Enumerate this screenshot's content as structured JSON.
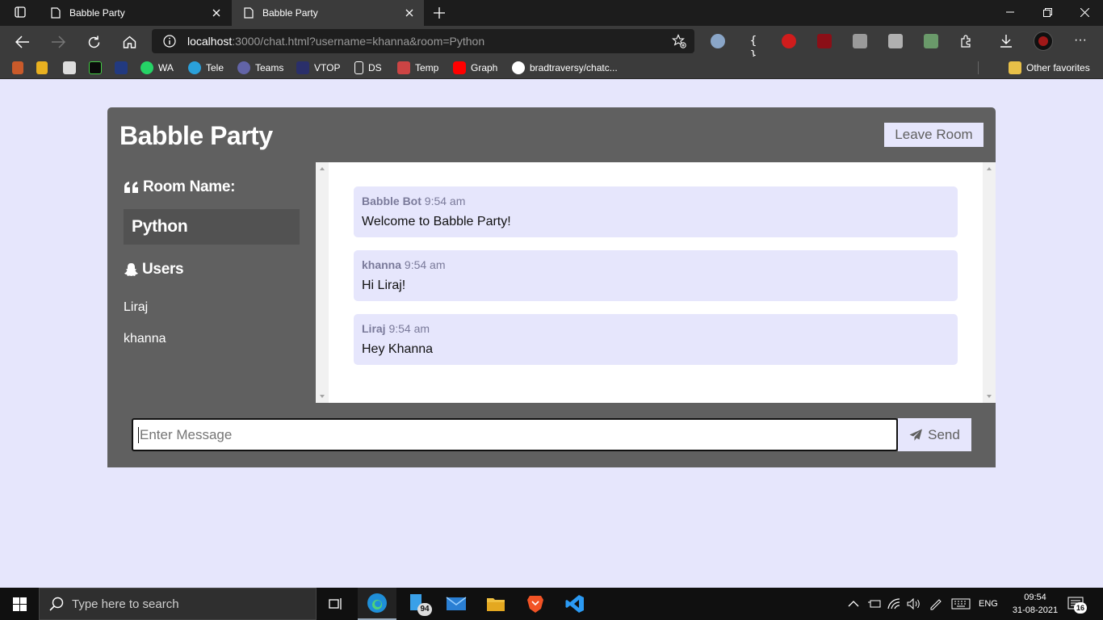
{
  "browser": {
    "tabs": [
      {
        "title": "Babble Party"
      },
      {
        "title": "Babble Party"
      }
    ],
    "url_host": "localhost",
    "url_rest": ":3000/chat.html?username=khanna&room=Python",
    "bookmarks": [
      "WA",
      "Tele",
      "Teams",
      "VTOP",
      "DS",
      "Temp",
      "Graph",
      "bradtraversy/chatc..."
    ],
    "other_favorites": "Other favorites"
  },
  "app": {
    "title": "Babble Party",
    "leave_label": "Leave Room",
    "room_heading": "Room Name:",
    "room_name": "Python",
    "users_heading": "Users",
    "users": [
      "Liraj",
      "khanna"
    ],
    "messages": [
      {
        "user": "Babble Bot",
        "time": "9:54 am",
        "text": "Welcome to Babble Party!"
      },
      {
        "user": "khanna",
        "time": "9:54 am",
        "text": "Hi Liraj!"
      },
      {
        "user": "Liraj",
        "time": "9:54 am",
        "text": "Hey Khanna"
      }
    ],
    "input_placeholder": "Enter Message",
    "send_label": "Send"
  },
  "taskbar": {
    "search_placeholder": "Type here to search",
    "badge_count": "94",
    "lang": "ENG",
    "time": "09:54",
    "date": "31-08-2021",
    "notification_count": "16"
  },
  "colors": {
    "page_bg": "#e6e6fc",
    "panel_bg": "#606060",
    "room_box_bg": "#525252"
  }
}
